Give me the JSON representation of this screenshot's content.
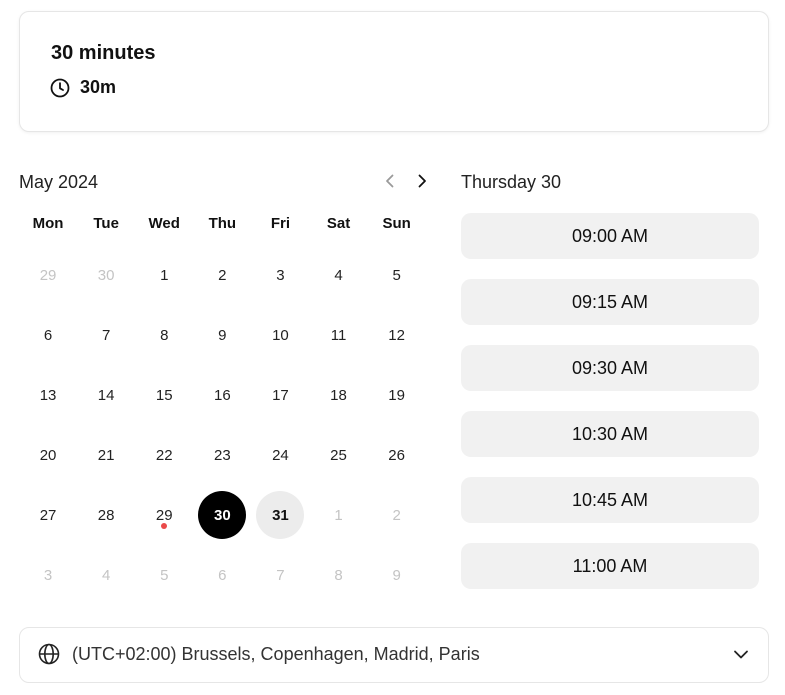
{
  "event": {
    "title": "30 minutes",
    "duration": "30m",
    "icon": "clock-icon"
  },
  "calendar": {
    "month_label": "May 2024",
    "weekdays": [
      "Mon",
      "Tue",
      "Wed",
      "Thu",
      "Fri",
      "Sat",
      "Sun"
    ],
    "days": [
      {
        "label": "29",
        "state": "muted"
      },
      {
        "label": "30",
        "state": "muted"
      },
      {
        "label": "1",
        "state": "normal"
      },
      {
        "label": "2",
        "state": "normal"
      },
      {
        "label": "3",
        "state": "normal"
      },
      {
        "label": "4",
        "state": "normal"
      },
      {
        "label": "5",
        "state": "normal"
      },
      {
        "label": "6",
        "state": "normal"
      },
      {
        "label": "7",
        "state": "normal"
      },
      {
        "label": "8",
        "state": "normal"
      },
      {
        "label": "9",
        "state": "normal"
      },
      {
        "label": "10",
        "state": "normal"
      },
      {
        "label": "11",
        "state": "normal"
      },
      {
        "label": "12",
        "state": "normal"
      },
      {
        "label": "13",
        "state": "normal"
      },
      {
        "label": "14",
        "state": "normal"
      },
      {
        "label": "15",
        "state": "normal"
      },
      {
        "label": "16",
        "state": "normal"
      },
      {
        "label": "17",
        "state": "normal"
      },
      {
        "label": "18",
        "state": "normal"
      },
      {
        "label": "19",
        "state": "normal"
      },
      {
        "label": "20",
        "state": "normal"
      },
      {
        "label": "21",
        "state": "normal"
      },
      {
        "label": "22",
        "state": "normal"
      },
      {
        "label": "23",
        "state": "normal"
      },
      {
        "label": "24",
        "state": "normal"
      },
      {
        "label": "25",
        "state": "normal"
      },
      {
        "label": "26",
        "state": "normal"
      },
      {
        "label": "27",
        "state": "normal"
      },
      {
        "label": "28",
        "state": "normal"
      },
      {
        "label": "29",
        "state": "today"
      },
      {
        "label": "30",
        "state": "selected"
      },
      {
        "label": "31",
        "state": "available"
      },
      {
        "label": "1",
        "state": "muted"
      },
      {
        "label": "2",
        "state": "muted"
      },
      {
        "label": "3",
        "state": "muted"
      },
      {
        "label": "4",
        "state": "muted"
      },
      {
        "label": "5",
        "state": "muted"
      },
      {
        "label": "6",
        "state": "muted"
      },
      {
        "label": "7",
        "state": "muted"
      },
      {
        "label": "8",
        "state": "muted"
      },
      {
        "label": "9",
        "state": "muted"
      }
    ],
    "colors": {
      "selected": "#000000",
      "available": "#ececec",
      "today_dot": "#ea4a4a",
      "muted_text": "#c4c4c4"
    }
  },
  "slots": {
    "day_label": "Thursday 30",
    "times": [
      "09:00 AM",
      "09:15 AM",
      "09:30 AM",
      "10:30 AM",
      "10:45 AM",
      "11:00 AM"
    ]
  },
  "timezone": {
    "label": "(UTC+02:00) Brussels, Copenhagen, Madrid, Paris",
    "icon": "globe-icon",
    "chevron": "chevron-down-icon"
  }
}
